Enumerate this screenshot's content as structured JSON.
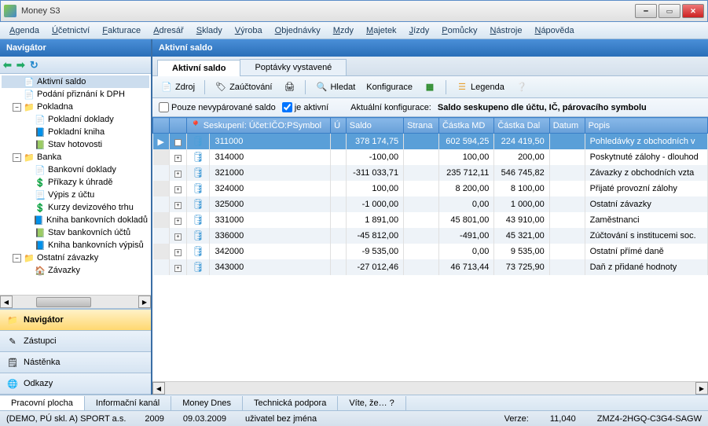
{
  "window": {
    "title": "Money S3"
  },
  "menu": [
    "Agenda",
    "Účetnictví",
    "Fakturace",
    "Adresář",
    "Sklady",
    "Výroba",
    "Objednávky",
    "Mzdy",
    "Majetek",
    "Jízdy",
    "Pomůcky",
    "Nástroje",
    "Nápověda"
  ],
  "sidebar": {
    "title": "Navigátor",
    "tree": [
      {
        "label": "Aktivní saldo",
        "lv": 1,
        "icon": "📄",
        "sel": true
      },
      {
        "label": "Podání přiznání k DPH",
        "lv": 1,
        "icon": "📄"
      },
      {
        "label": "Pokladna",
        "lv": 1,
        "icon": "📁",
        "exp": "-"
      },
      {
        "label": "Pokladní doklady",
        "lv": 2,
        "icon": "📄"
      },
      {
        "label": "Pokladní kniha",
        "lv": 2,
        "icon": "📘"
      },
      {
        "label": "Stav hotovosti",
        "lv": 2,
        "icon": "📗"
      },
      {
        "label": "Banka",
        "lv": 1,
        "icon": "📁",
        "exp": "-"
      },
      {
        "label": "Bankovní doklady",
        "lv": 2,
        "icon": "📄"
      },
      {
        "label": "Příkazy k úhradě",
        "lv": 2,
        "icon": "💲"
      },
      {
        "label": "Výpis z účtu",
        "lv": 2,
        "icon": "📃"
      },
      {
        "label": "Kurzy devizového trhu",
        "lv": 2,
        "icon": "💲"
      },
      {
        "label": "Kniha bankovních dokladů",
        "lv": 2,
        "icon": "📘"
      },
      {
        "label": "Stav bankovních účtů",
        "lv": 2,
        "icon": "📗"
      },
      {
        "label": "Kniha bankovních výpisů",
        "lv": 2,
        "icon": "📘"
      },
      {
        "label": "Ostatní závazky",
        "lv": 1,
        "icon": "📁",
        "exp": "-"
      },
      {
        "label": "Závazky",
        "lv": 2,
        "icon": "🏠"
      }
    ],
    "nav": [
      {
        "label": "Navigátor",
        "icon": "📁",
        "active": true
      },
      {
        "label": "Zástupci",
        "icon": "✎"
      },
      {
        "label": "Nástěnka",
        "icon": "🗒"
      },
      {
        "label": "Odkazy",
        "icon": "🌐"
      }
    ]
  },
  "content": {
    "title": "Aktivní saldo",
    "tabs": [
      {
        "label": "Aktivní saldo",
        "active": true
      },
      {
        "label": "Poptávky vystavené"
      }
    ],
    "toolbar": {
      "zdroj": "Zdroj",
      "zauctovani": "Zaúčtování",
      "hledat": "Hledat",
      "konfigurace": "Konfigurace",
      "legenda": "Legenda"
    },
    "filter": {
      "chk1": "Pouze nevypárované saldo",
      "chk1_checked": false,
      "chk2": "je aktivní",
      "chk2_checked": true,
      "cfg_label": "Aktuální konfigurace:",
      "cfg_value": "Saldo seskupeno dle účtu, IČ, párovacího symbolu"
    },
    "grid": {
      "group_header": "Seskupení: Účet:IČO:PSymbol",
      "columns": [
        "Ú",
        "Saldo",
        "Strana",
        "Částka MD",
        "Částka Dal",
        "Datum",
        "Popis"
      ],
      "rows": [
        {
          "g": "311000",
          "saldo": "378 174,75",
          "strana": "",
          "md": "602 594,25",
          "dal": "224 419,50",
          "datum": "",
          "popis": "Pohledávky z obchodních v",
          "sel": true
        },
        {
          "g": "314000",
          "saldo": "-100,00",
          "strana": "",
          "md": "100,00",
          "dal": "200,00",
          "datum": "",
          "popis": "Poskytnuté zálohy - dlouhod"
        },
        {
          "g": "321000",
          "saldo": "-311 033,71",
          "strana": "",
          "md": "235 712,11",
          "dal": "546 745,82",
          "datum": "",
          "popis": "Závazky z obchodních vzta",
          "alt": true
        },
        {
          "g": "324000",
          "saldo": "100,00",
          "strana": "",
          "md": "8 200,00",
          "dal": "8 100,00",
          "datum": "",
          "popis": "Přijaté provozní zálohy"
        },
        {
          "g": "325000",
          "saldo": "-1 000,00",
          "strana": "",
          "md": "0,00",
          "dal": "1 000,00",
          "datum": "",
          "popis": "Ostatní závazky",
          "alt": true
        },
        {
          "g": "331000",
          "saldo": "1 891,00",
          "strana": "",
          "md": "45 801,00",
          "dal": "43 910,00",
          "datum": "",
          "popis": "Zaměstnanci"
        },
        {
          "g": "336000",
          "saldo": "-45 812,00",
          "strana": "",
          "md": "-491,00",
          "dal": "45 321,00",
          "datum": "",
          "popis": "Zúčtování s institucemi soc.",
          "alt": true
        },
        {
          "g": "342000",
          "saldo": "-9 535,00",
          "strana": "",
          "md": "0,00",
          "dal": "9 535,00",
          "datum": "",
          "popis": "Ostatní přímé daně"
        },
        {
          "g": "343000",
          "saldo": "-27 012,46",
          "strana": "",
          "md": "46 713,44",
          "dal": "73 725,90",
          "datum": "",
          "popis": "Daň z přidané hodnoty",
          "alt": true
        }
      ]
    }
  },
  "bottom_tabs": [
    {
      "label": "Pracovní plocha",
      "active": true
    },
    {
      "label": "Informační kanál"
    },
    {
      "label": "Money Dnes"
    },
    {
      "label": "Technická podpora"
    },
    {
      "label": "Víte, že… ?"
    }
  ],
  "status": {
    "agenda": "(DEMO, PÚ skl. A) SPORT a.s.",
    "year": "2009",
    "date": "09.03.2009",
    "user": "uživatel bez jména",
    "ver_label": "Verze:",
    "ver": "11,040",
    "serial": "ZMZ4-2HGQ-C3G4-SAGW"
  }
}
